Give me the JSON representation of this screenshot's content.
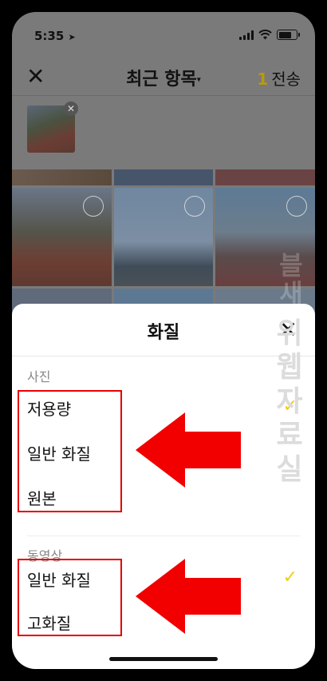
{
  "status_bar": {
    "time": "5:35",
    "location_icon": "location-arrow-icon",
    "battery_level": 0.75
  },
  "header": {
    "title": "최근 항목",
    "send_count": "1",
    "send_label": "전송"
  },
  "sheet": {
    "title": "화질",
    "sections": [
      {
        "label": "사진",
        "options": [
          "저용량",
          "일반 화질",
          "원본"
        ],
        "selected_index": 0
      },
      {
        "label": "동영상",
        "options": [
          "일반 화질",
          "고화질"
        ],
        "selected_index": 0
      }
    ]
  },
  "watermark": {
    "text": "위웹자료실",
    "faded_top": "블새"
  },
  "colors": {
    "check": "#f2cc1c",
    "annotation": "#e60000",
    "send_count": "#b79a10"
  }
}
